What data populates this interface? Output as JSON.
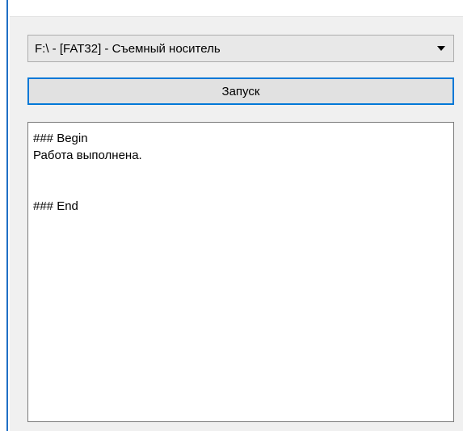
{
  "drive_selector": {
    "selected_value": "F:\\ -  [FAT32] - Съемный носитель"
  },
  "run_button": {
    "label": "Запуск"
  },
  "log": {
    "lines": [
      "### Begin",
      "Работа выполнена.",
      "",
      "",
      "### End"
    ]
  }
}
